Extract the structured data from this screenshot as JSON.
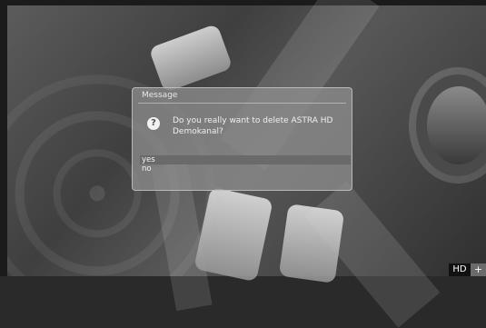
{
  "dialog": {
    "title": "Message",
    "message": "Do you really want to delete ASTRA HD Demokanal?",
    "icon": "question-icon",
    "options": [
      {
        "label": "yes",
        "selected": true
      },
      {
        "label": "no",
        "selected": false
      }
    ]
  },
  "status": {
    "hd_label": "HD",
    "plus_label": "+"
  },
  "colors": {
    "dialog_background": "#8c8c8c",
    "selection": "#6a6a6a",
    "text": "#efefef"
  }
}
